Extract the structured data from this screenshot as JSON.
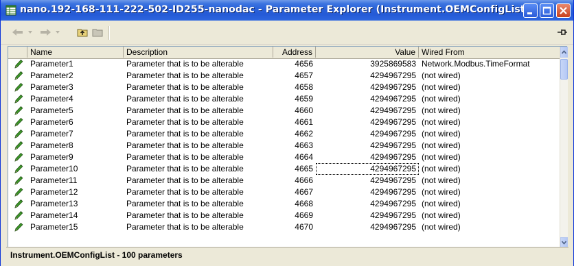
{
  "window": {
    "title": "nano.192-168-111-222-502-ID255-nanodac - Parameter Explorer (Instrument.OEMConfigList)"
  },
  "toolbar": {
    "back_icon": "back-arrow-icon",
    "forward_icon": "forward-arrow-icon",
    "up_folder_icon": "up-folder-icon",
    "folder_icon": "folder-icon",
    "pin_icon": "pin-icon"
  },
  "table": {
    "columns": [
      "Name",
      "Description",
      "Address",
      "Value",
      "Wired From"
    ],
    "rows": [
      {
        "name": "Parameter1",
        "description": "Parameter that is to be alterable",
        "address": "4656",
        "value": "3925869583",
        "wired_from": "Network.Modbus.TimeFormat"
      },
      {
        "name": "Parameter2",
        "description": "Parameter that is to be alterable",
        "address": "4657",
        "value": "4294967295",
        "wired_from": "(not wired)"
      },
      {
        "name": "Parameter3",
        "description": "Parameter that is to be alterable",
        "address": "4658",
        "value": "4294967295",
        "wired_from": "(not wired)"
      },
      {
        "name": "Parameter4",
        "description": "Parameter that is to be alterable",
        "address": "4659",
        "value": "4294967295",
        "wired_from": "(not wired)"
      },
      {
        "name": "Parameter5",
        "description": "Parameter that is to be alterable",
        "address": "4660",
        "value": "4294967295",
        "wired_from": "(not wired)"
      },
      {
        "name": "Parameter6",
        "description": "Parameter that is to be alterable",
        "address": "4661",
        "value": "4294967295",
        "wired_from": "(not wired)"
      },
      {
        "name": "Parameter7",
        "description": "Parameter that is to be alterable",
        "address": "4662",
        "value": "4294967295",
        "wired_from": "(not wired)"
      },
      {
        "name": "Parameter8",
        "description": "Parameter that is to be alterable",
        "address": "4663",
        "value": "4294967295",
        "wired_from": "(not wired)"
      },
      {
        "name": "Parameter9",
        "description": "Parameter that is to be alterable",
        "address": "4664",
        "value": "4294967295",
        "wired_from": "(not wired)"
      },
      {
        "name": "Parameter10",
        "description": "Parameter that is to be alterable",
        "address": "4665",
        "value": "4294967295",
        "wired_from": "(not wired)"
      },
      {
        "name": "Parameter11",
        "description": "Parameter that is to be alterable",
        "address": "4666",
        "value": "4294967295",
        "wired_from": "(not wired)"
      },
      {
        "name": "Parameter12",
        "description": "Parameter that is to be alterable",
        "address": "4667",
        "value": "4294967295",
        "wired_from": "(not wired)"
      },
      {
        "name": "Parameter13",
        "description": "Parameter that is to be alterable",
        "address": "4668",
        "value": "4294967295",
        "wired_from": "(not wired)"
      },
      {
        "name": "Parameter14",
        "description": "Parameter that is to be alterable",
        "address": "4669",
        "value": "4294967295",
        "wired_from": "(not wired)"
      },
      {
        "name": "Parameter15",
        "description": "Parameter that is to be alterable",
        "address": "4670",
        "value": "4294967295",
        "wired_from": "(not wired)"
      }
    ],
    "row_icon": "pencil-edit-icon",
    "focused_row_index": 9
  },
  "status": {
    "text": "Instrument.OEMConfigList  -  100 parameters"
  }
}
